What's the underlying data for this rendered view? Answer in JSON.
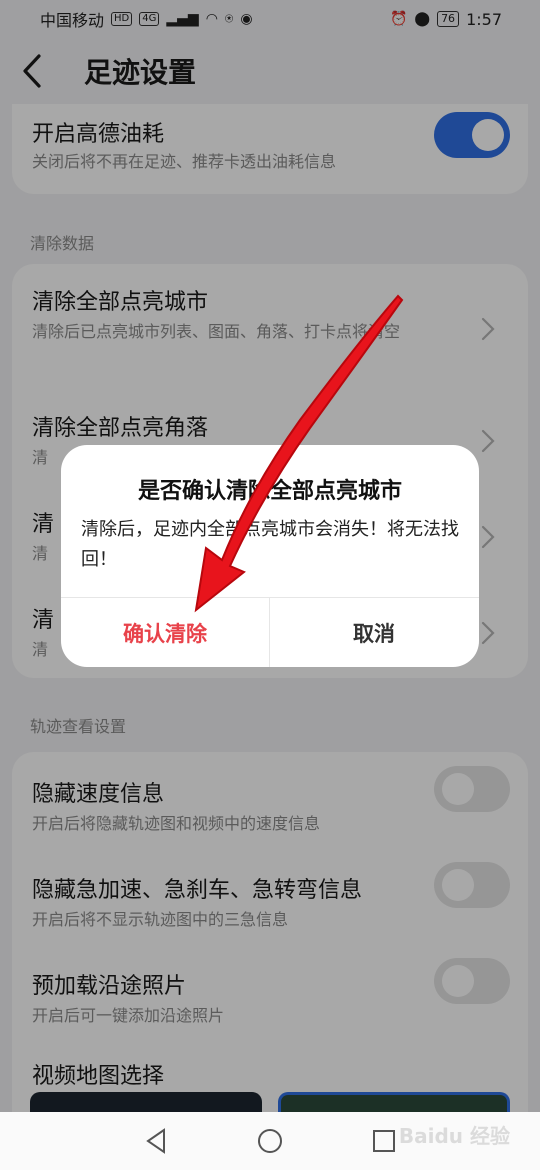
{
  "status_bar": {
    "carrier": "中国移动",
    "hd": "HD",
    "network": "4G",
    "battery": "76",
    "time": "1:57"
  },
  "header": {
    "title": "足迹设置"
  },
  "settings": {
    "fuel": {
      "title": "开启高德油耗",
      "subtitle": "关闭后将不再在足迹、推荐卡透出油耗信息",
      "enabled": true
    },
    "clear_section_label": "清除数据",
    "clear_items": [
      {
        "title": "清除全部点亮城市",
        "subtitle": "清除后已点亮城市列表、图面、角落、打卡点将清空"
      },
      {
        "title": "清除全部点亮角落",
        "subtitle": "清"
      },
      {
        "title": "清",
        "subtitle": "清"
      },
      {
        "title": "清",
        "subtitle": "清"
      }
    ],
    "track_section_label": "轨迹查看设置",
    "track_items": [
      {
        "title": "隐藏速度信息",
        "subtitle": "开启后将隐藏轨迹图和视频中的速度信息",
        "enabled": false
      },
      {
        "title": "隐藏急加速、急刹车、急转弯信息",
        "subtitle": "开启后将不显示轨迹图中的三急信息",
        "enabled": false
      },
      {
        "title": "预加载沿途照片",
        "subtitle": "开启后可一键添加沿途照片",
        "enabled": false
      }
    ],
    "video_map_label": "视频地图选择"
  },
  "dialog": {
    "title": "是否确认清除全部点亮城市",
    "message": "清除后，足迹内全部点亮城市会消失！将无法找回！",
    "confirm_label": "确认清除",
    "cancel_label": "取消"
  },
  "watermark": "Baidu 经验",
  "colors": {
    "accent_blue": "#2f6fe4",
    "danger_red": "#e8424a",
    "annotation_arrow": "#e8141c"
  },
  "icons": {
    "back": "chevron-left-icon",
    "row_arrow": "chevron-right-icon",
    "nav_back": "triangle-back-icon",
    "nav_home": "circle-home-icon",
    "nav_recent": "square-recent-icon"
  }
}
